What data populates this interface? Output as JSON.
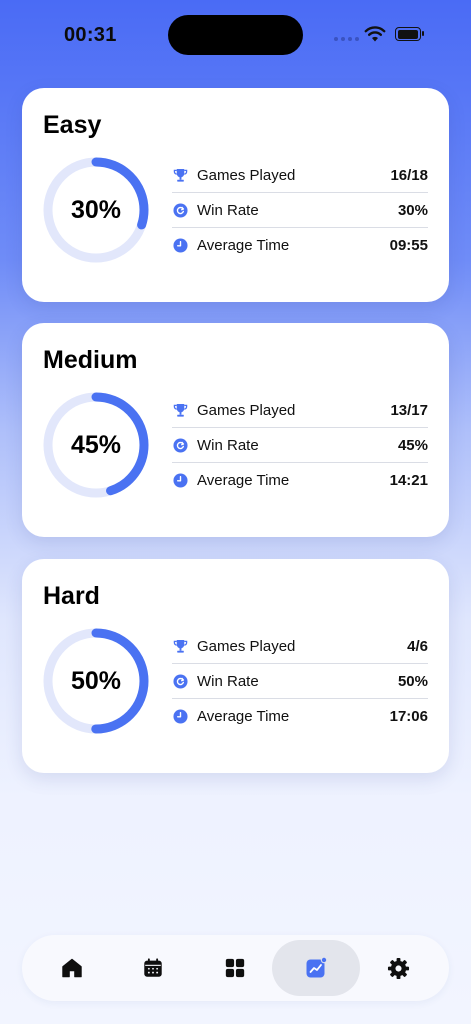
{
  "status": {
    "time": "00:31"
  },
  "colors": {
    "accent": "#4a72f2",
    "track": "#e2e7fb"
  },
  "stat_labels": {
    "games": "Games Played",
    "win": "Win Rate",
    "avg": "Average Time"
  },
  "cards": [
    {
      "title": "Easy",
      "progress_percent": 30,
      "progress_label": "30%",
      "games_played": "16/18",
      "win_rate": "30%",
      "average_time": "09:55"
    },
    {
      "title": "Medium",
      "progress_percent": 45,
      "progress_label": "45%",
      "games_played": "13/17",
      "win_rate": "45%",
      "average_time": "14:21"
    },
    {
      "title": "Hard",
      "progress_percent": 50,
      "progress_label": "50%",
      "games_played": "4/6",
      "win_rate": "50%",
      "average_time": "17:06"
    }
  ],
  "tabs": [
    {
      "icon": "home-icon",
      "active": false
    },
    {
      "icon": "calendar-icon",
      "active": false
    },
    {
      "icon": "grid-icon",
      "active": false
    },
    {
      "icon": "statistics-icon",
      "active": true
    },
    {
      "icon": "gear-icon",
      "active": false
    }
  ]
}
